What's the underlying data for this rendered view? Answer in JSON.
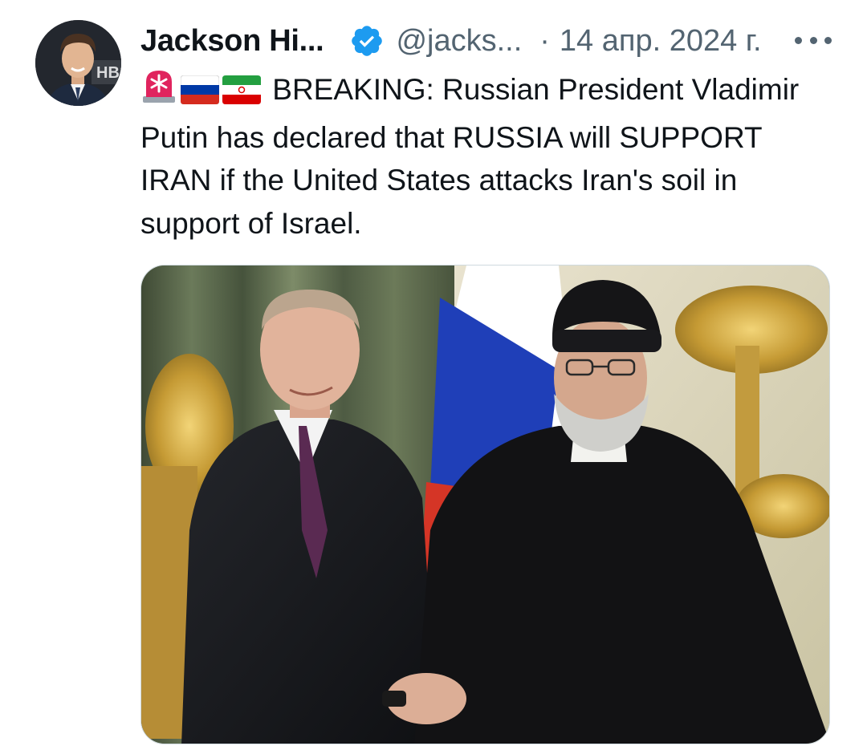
{
  "tweet": {
    "author_name": "Jackson Hi...",
    "author_handle": "@jacks...",
    "separator": "·",
    "date": "14 апр. 2024 г.",
    "text": "BREAKING: Russian President Vladimir Putin has declared that RUSSIA will SUPPORT IRAN if the United States attacks Iran's soil in support of Israel.",
    "emojis": [
      "siren-emoji",
      "russia-flag-emoji",
      "iran-flag-emoji"
    ]
  },
  "icons": {
    "verified": "verified-badge-icon",
    "more": "more-options-icon"
  },
  "colors": {
    "verified_blue": "#1d9bf0",
    "secondary_text": "#536471",
    "primary_text": "#0f1419",
    "border": "#cfd9de"
  }
}
